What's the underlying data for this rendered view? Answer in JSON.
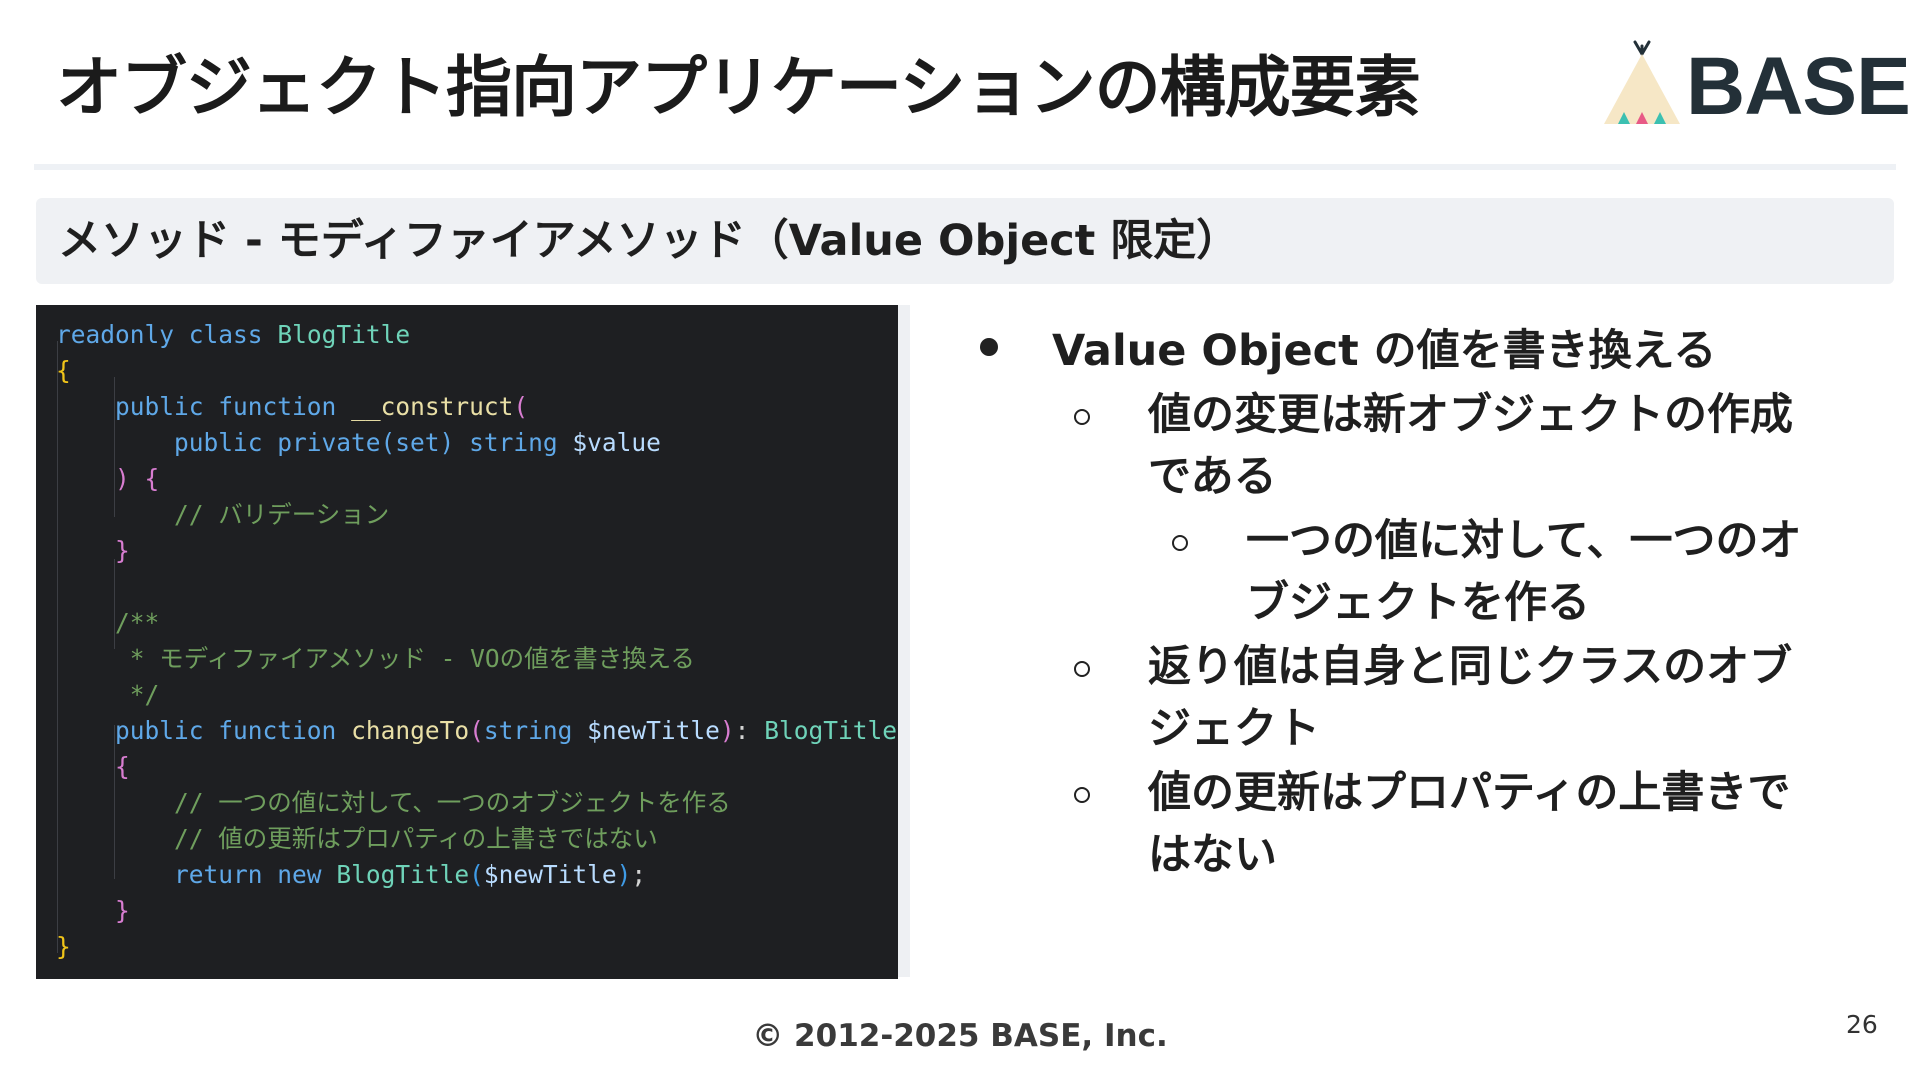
{
  "slide": {
    "title": "オブジェクト指向アプリケーションの構成要素",
    "logo_text": "BASE",
    "section_heading": "メソッド - モディファイアメソッド（Value Object 限定）",
    "footer": "© 2012-2025 BASE, Inc.",
    "page_number": "26"
  },
  "code": {
    "lines": [
      [
        "readonly",
        "class",
        "BlogTitle"
      ],
      [
        "{"
      ],
      [
        "public",
        "function",
        "__construct",
        "("
      ],
      [
        "public",
        "private(set)",
        "string",
        "$value"
      ],
      [
        ")",
        "{"
      ],
      [
        "// バリデーション"
      ],
      [
        "}"
      ],
      [],
      [
        "/**"
      ],
      [
        " * モディファイアメソッド - VOの値を書き換える"
      ],
      [
        " */"
      ],
      [
        "public",
        "function",
        "changeTo",
        "(",
        "string",
        "$newTitle",
        ")",
        ":",
        "BlogTitle"
      ],
      [
        "{"
      ],
      [
        "// 一つの値に対して、一つのオブジェクトを作る"
      ],
      [
        "// 値の更新はプロパティの上書きではない"
      ],
      [
        "return",
        "new",
        "BlogTitle",
        "(",
        "$newTitle",
        ")",
        ";"
      ],
      [
        "}"
      ],
      [
        "}"
      ]
    ]
  },
  "bullets": {
    "main": "Value Object の値を書き換える",
    "sub1_line1": "値の変更は新オブジェクトの作成",
    "sub1_line2": "である",
    "subsub1_line1": "一つの値に対して、一つのオ",
    "subsub1_line2": "ブジェクトを作る",
    "sub2_line1": "返り値は自身と同じクラスのオブ",
    "sub2_line2": "ジェクト",
    "sub3_line1": "値の更新はプロパティの上書きで",
    "sub3_line2": "はない"
  },
  "colors": {
    "code_background": "#1e1f22",
    "section_bar": "#eff1f4",
    "logo_text": "#233038"
  }
}
